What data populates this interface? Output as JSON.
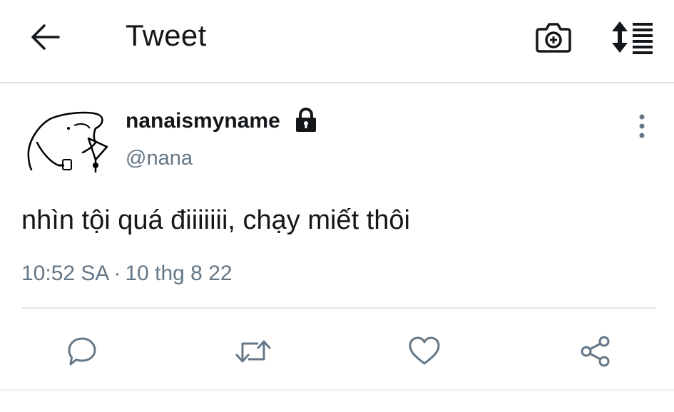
{
  "header": {
    "back_icon": "arrow-left-icon",
    "title": "Tweet",
    "camera_icon": "camera-plus-icon",
    "sort_icon": "sort-list-icon"
  },
  "tweet": {
    "display_name": "nanaismyname",
    "protected_icon": "lock-icon",
    "handle": "@nana",
    "text": "nhìn tội quá điiiiiii, chạy miết thôi",
    "time": "10:52 SA",
    "separator": "·",
    "date": "10 thg 8 22",
    "more_icon": "more-vertical-icon"
  },
  "actions": {
    "reply_icon": "reply-icon",
    "retweet_icon": "retweet-icon",
    "like_icon": "heart-icon",
    "share_icon": "share-icon"
  },
  "colors": {
    "text": "#14171a",
    "secondary": "#657786",
    "icon": "#657786",
    "divider": "#e1e4e8"
  }
}
